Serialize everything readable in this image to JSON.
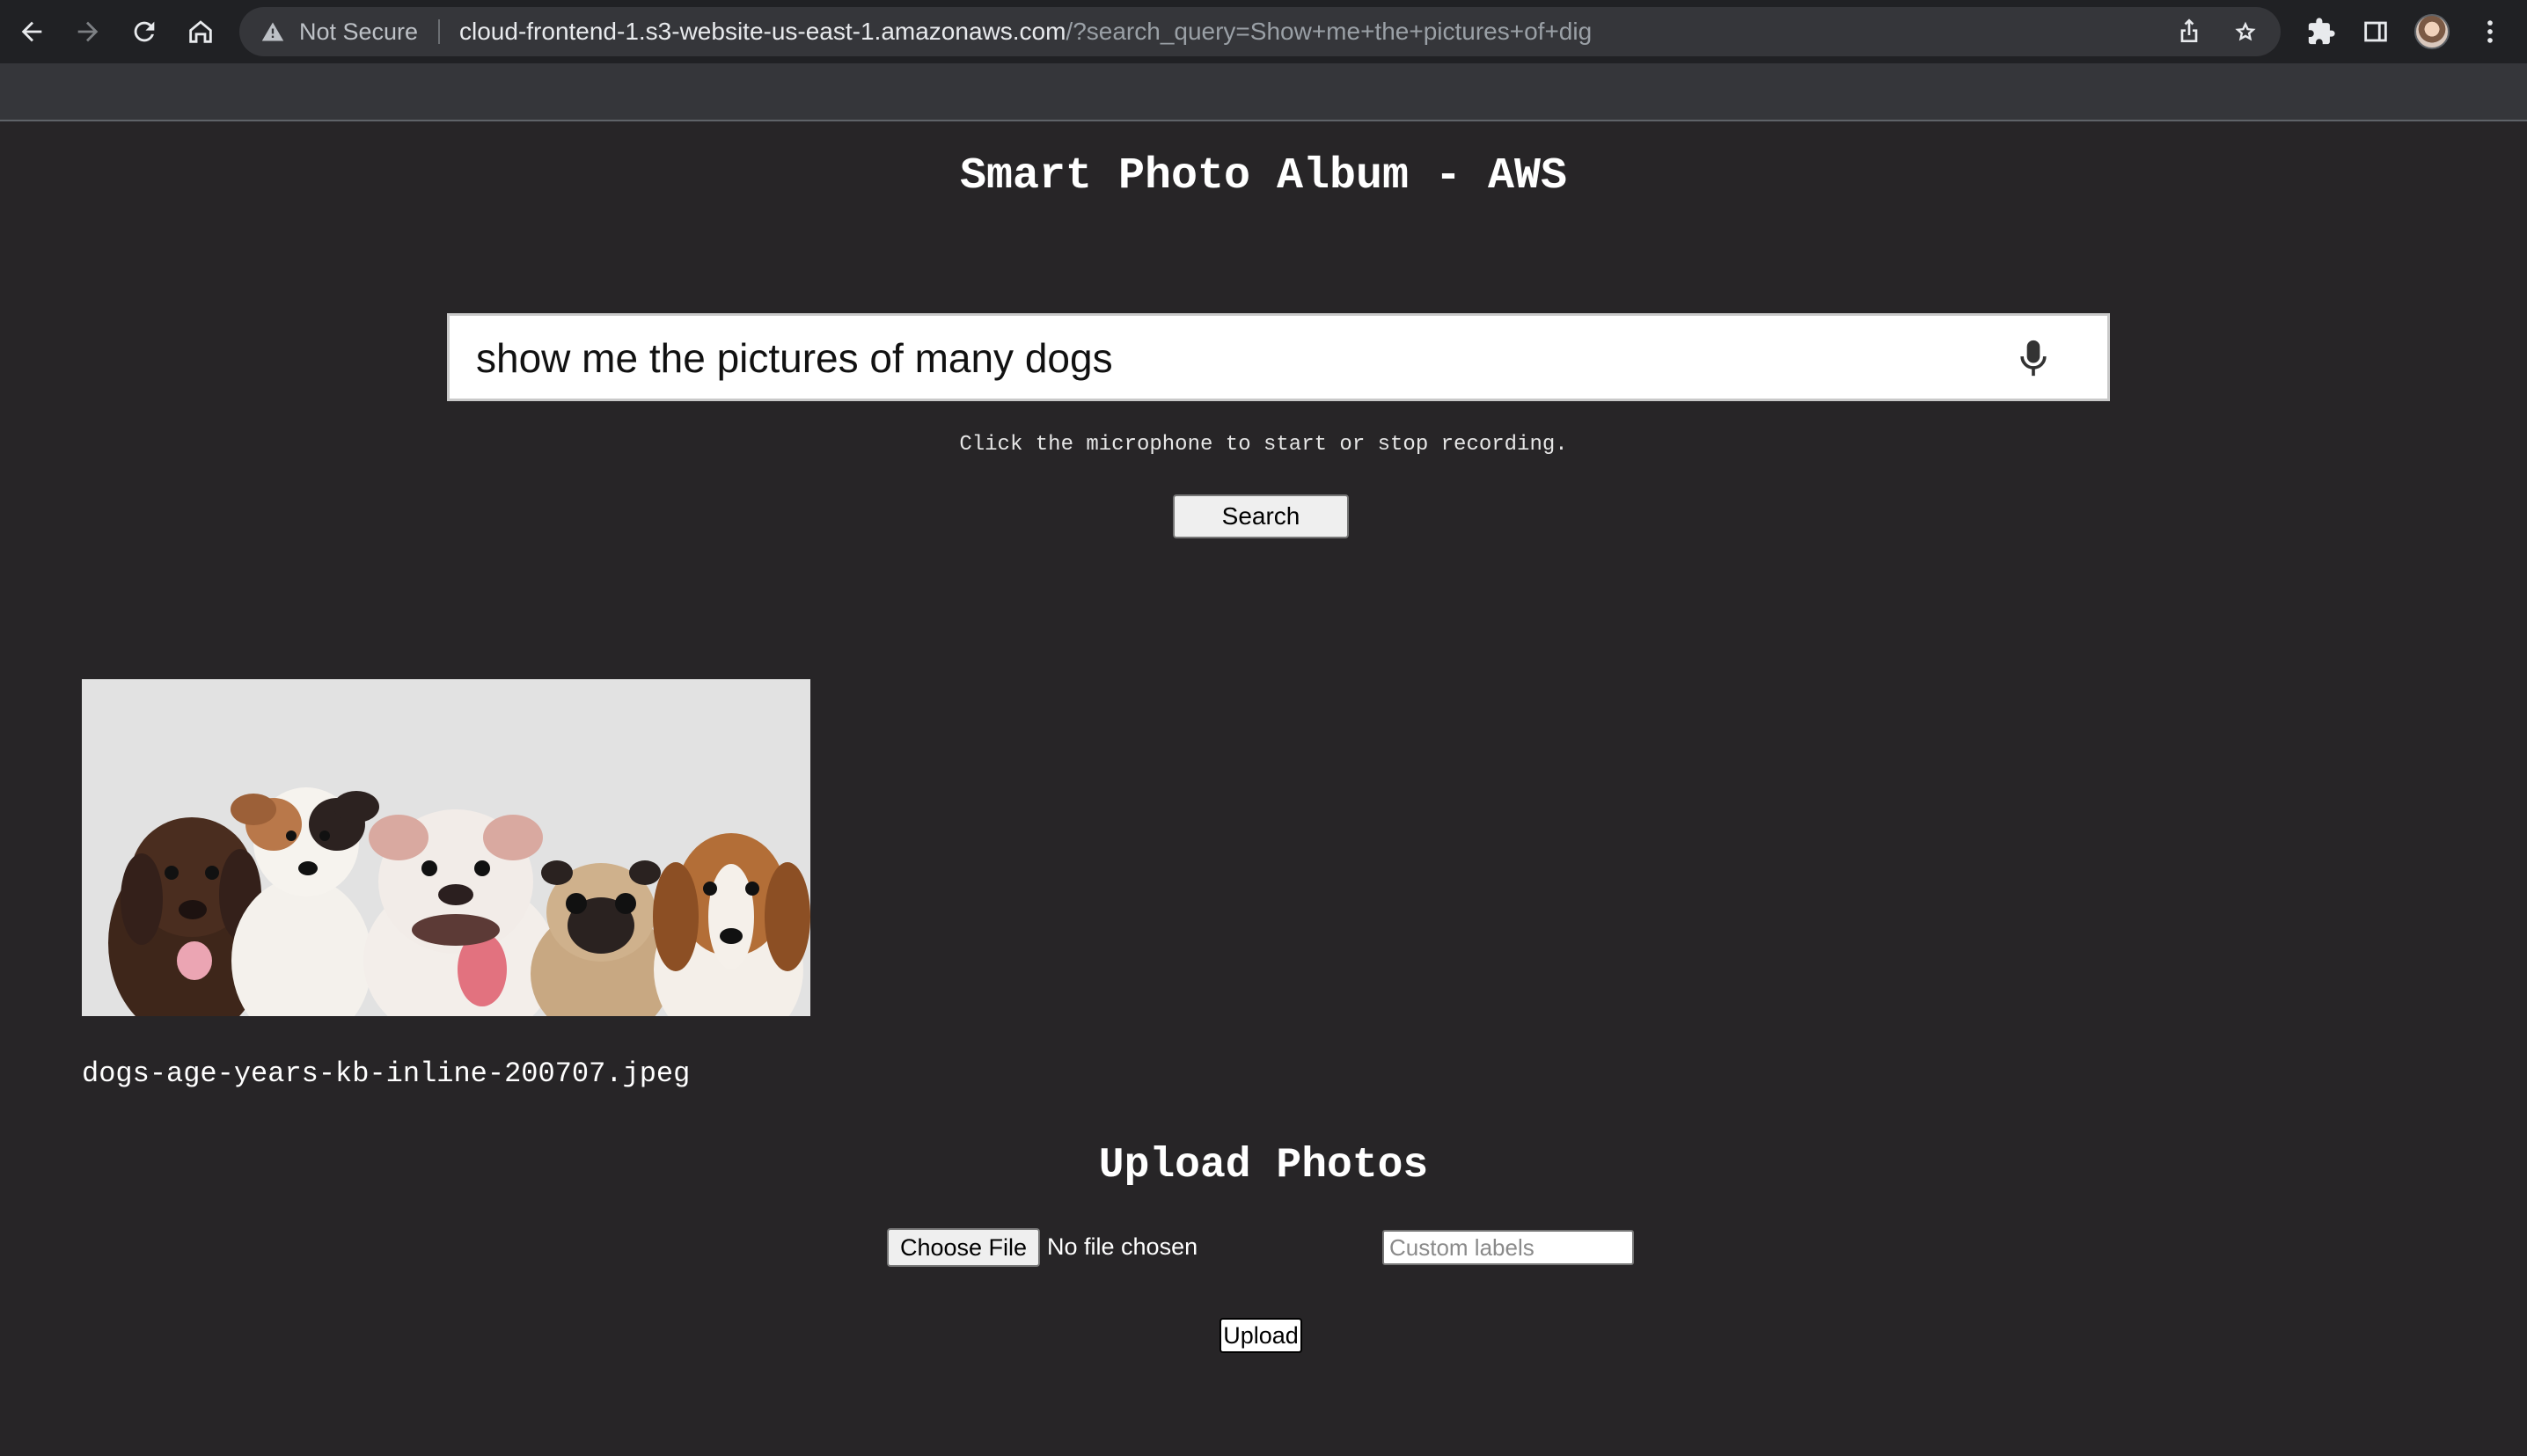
{
  "browser": {
    "security_label": "Not Secure",
    "url_host": "cloud-frontend-1.s3-website-us-east-1.amazonaws.com",
    "url_path": "/?search_query=Show+me+the+pictures+of+dig",
    "icons": [
      "back-icon",
      "forward-icon",
      "reload-icon",
      "home-icon",
      "warning-icon",
      "share-icon",
      "star-icon",
      "extensions-icon",
      "side-panel-icon",
      "profile-avatar",
      "menu-icon"
    ]
  },
  "page": {
    "title": "Smart Photo Album - AWS"
  },
  "search": {
    "query": "show me the pictures of many dogs",
    "hint": "Click the microphone to start or stop recording.",
    "button_label": "Search",
    "mic_icon": "microphone-icon"
  },
  "results": [
    {
      "filename": "dogs-age-years-kb-inline-200707.jpeg"
    }
  ],
  "upload": {
    "title": "Upload Photos",
    "choose_file_label": "Choose File",
    "file_status": "No file chosen",
    "labels_placeholder": "Custom labels",
    "button_label": "Upload"
  },
  "colors": {
    "page_background": "#272527",
    "chrome_background": "#202124",
    "text": "#ffffff"
  }
}
